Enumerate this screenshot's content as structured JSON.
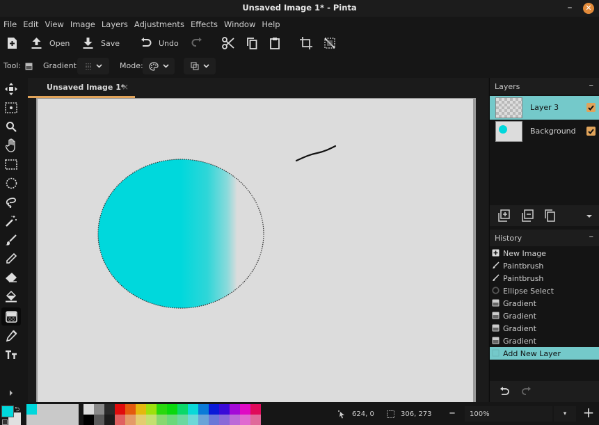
{
  "window": {
    "title": "Unsaved Image 1* - Pinta",
    "minimize_glyph": "–",
    "close_glyph": "✕",
    "close_color": "#e38b3a"
  },
  "menu": [
    "File",
    "Edit",
    "View",
    "Image",
    "Layers",
    "Adjustments",
    "Effects",
    "Window",
    "Help"
  ],
  "toolbar": {
    "new_icon": "new-image-icon",
    "open_label": "Open",
    "save_label": "Save",
    "undo_label": "Undo",
    "redo_icon": "redo-icon",
    "cut_icon": "cut-icon",
    "copy_icon": "copy-icon",
    "paste_icon": "paste-icon",
    "crop_icon": "crop-to-selection-icon",
    "deselect_icon": "deselect-all-icon"
  },
  "options": {
    "tool_label": "Tool:",
    "gradient_label": "Gradient:",
    "mode_label": "Mode:"
  },
  "tools": [
    "move-selected-icon",
    "move-selection-icon",
    "zoom-icon",
    "pan-icon",
    "rectangle-select-icon",
    "ellipse-select-icon",
    "lasso-select-icon",
    "magic-wand-icon",
    "paintbrush-icon",
    "pencil-icon",
    "eraser-icon",
    "paint-bucket-icon",
    "gradient-icon",
    "color-picker-icon",
    "text-icon"
  ],
  "active_tool": "gradient-icon",
  "document": {
    "tab_title": "Unsaved Image 1*",
    "tab_close": "×",
    "accent": "#e0a35a"
  },
  "layers": {
    "title": "Layers",
    "collapse_glyph": "–",
    "items": [
      {
        "name": "Layer 3",
        "visible": true,
        "selected": true
      },
      {
        "name": "Background",
        "visible": true,
        "selected": false
      }
    ]
  },
  "history": {
    "title": "History",
    "collapse_glyph": "–",
    "items": [
      {
        "label": "New Image",
        "icon": "new-image-icon"
      },
      {
        "label": "Paintbrush",
        "icon": "paintbrush-icon"
      },
      {
        "label": "Paintbrush",
        "icon": "paintbrush-icon"
      },
      {
        "label": "Ellipse Select",
        "icon": "ellipse-select-icon"
      },
      {
        "label": "Gradient",
        "icon": "gradient-icon"
      },
      {
        "label": "Gradient",
        "icon": "gradient-icon"
      },
      {
        "label": "Gradient",
        "icon": "gradient-icon"
      },
      {
        "label": "Gradient",
        "icon": "gradient-icon"
      },
      {
        "label": "Add New Layer",
        "icon": "add-layer-icon",
        "selected": true
      }
    ]
  },
  "palette": {
    "primary": "#00d8dc",
    "secondary": "#e0e0e0",
    "recent": [
      "#00d8dc"
    ],
    "swatches_top": [
      "#dcdcdc",
      "#8a8a8a",
      "#2a2a2a",
      "#e00c0c",
      "#e45a0e",
      "#e4b80e",
      "#9ee00e",
      "#2ad80e",
      "#0ad80e",
      "#0ad86a",
      "#0ad8d8",
      "#0a7ad8",
      "#0a1ad8",
      "#3a0ad8",
      "#a40ad8",
      "#e00ac4",
      "#e00a5a"
    ],
    "swatches_bottom": [
      "#000000",
      "#5a5a5a",
      "#1c1c1c",
      "#e06060",
      "#e49a68",
      "#e4cc70",
      "#c4e070",
      "#88d870",
      "#6cd87a",
      "#6cd8a0",
      "#6cd8d8",
      "#6aa4d8",
      "#6a78d8",
      "#8a6ad8",
      "#bc6ad8",
      "#e06ad0",
      "#e06a9a"
    ]
  },
  "status": {
    "cursor_pos": "624, 0",
    "selection_size": "306, 273",
    "zoom": "100%",
    "zoom_minus": "–",
    "zoom_plus": "+",
    "zoom_drop": "▾"
  }
}
